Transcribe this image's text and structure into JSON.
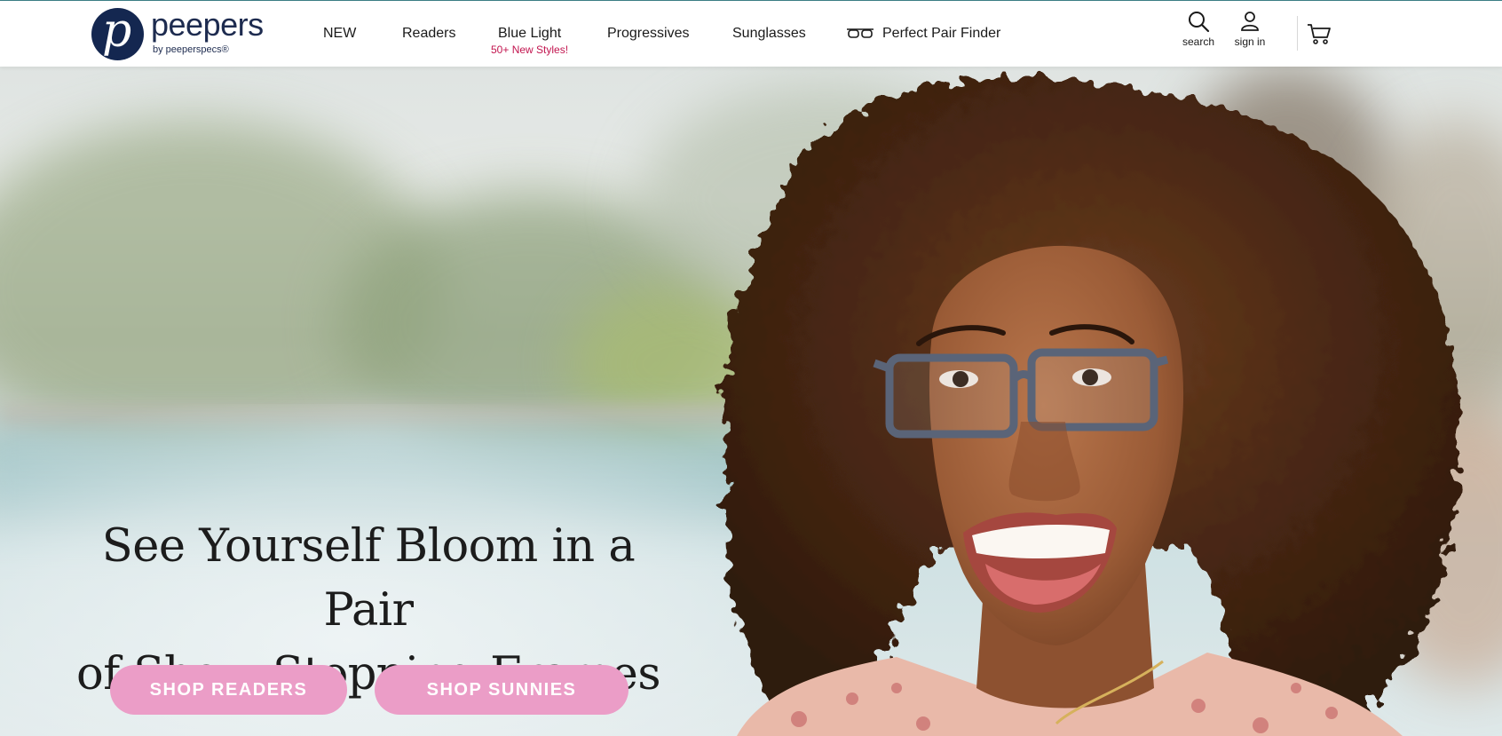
{
  "brand": {
    "logo_letter": "p",
    "name": "peepers",
    "byline": "by peeperspecs®"
  },
  "nav": {
    "items": [
      {
        "label": "NEW"
      },
      {
        "label": "Readers"
      },
      {
        "label": "Blue Light",
        "sub": "50+ New Styles!"
      },
      {
        "label": "Progressives"
      },
      {
        "label": "Sunglasses"
      },
      {
        "label": "Perfect Pair Finder",
        "icon": "glasses-icon"
      }
    ]
  },
  "utility": {
    "search_label": "search",
    "signin_label": "sign in",
    "cart_icon": "cart-icon"
  },
  "hero": {
    "headline_line1": "See Yourself Bloom in a Pair",
    "headline_line2": "of Show-Stopping Frames",
    "cta_readers": "SHOP READERS",
    "cta_sunnies": "SHOP SUNNIES"
  },
  "colors": {
    "brand_navy": "#142750",
    "accent_pink": "#eb9dc7",
    "sub_text_red": "#c2154f"
  }
}
